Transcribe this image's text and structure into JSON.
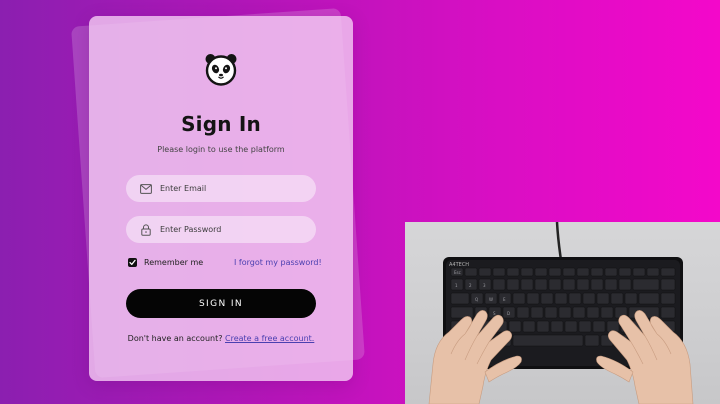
{
  "login": {
    "title": "Sign In",
    "subtitle": "Please login to use the platform",
    "email_placeholder": "Enter Email",
    "password_placeholder": "Enter Password",
    "remember_label": "Remember me",
    "remember_checked": true,
    "forgot_label": "I forgot my password!",
    "signin_label": "SIGN IN",
    "no_account_text": "Don't have an account?",
    "create_account_label": "Create a free account."
  },
  "icons": {
    "logo": "panda-icon",
    "email": "mail-icon",
    "password": "lock-icon",
    "checkbox": "check-icon"
  },
  "colors": {
    "background_left": "#8b1fb0",
    "background_right": "#f408ca",
    "card": "#f2c8f2",
    "button": "#050505",
    "link": "#4a3fb0"
  },
  "webcam": {
    "keyboard_brand": "A4TECH"
  }
}
